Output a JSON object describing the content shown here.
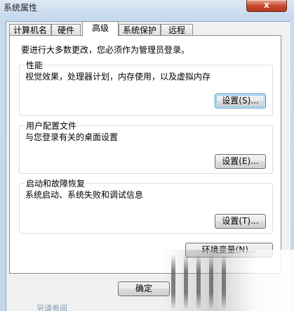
{
  "window": {
    "title": "系统属性",
    "close_label": "x"
  },
  "tabs": [
    {
      "label": "计算机名",
      "active": false
    },
    {
      "label": "硬件",
      "active": false
    },
    {
      "label": "高级",
      "active": true
    },
    {
      "label": "系统保护",
      "active": false
    },
    {
      "label": "远程",
      "active": false
    }
  ],
  "panel": {
    "note": "要进行大多数更改，您必须作为管理员登录。",
    "performance": {
      "title": "性能",
      "description": "视觉效果，处理器计划，内存使用，以及虚拟内存",
      "button": "设置(S)..."
    },
    "user_profiles": {
      "title": "用户配置文件",
      "description": "与您登录有关的桌面设置",
      "button": "设置(E)..."
    },
    "startup_recovery": {
      "title": "启动和故障恢复",
      "description": "系统启动、系统失败和调试信息",
      "button": "设置(T)..."
    },
    "env_button": "环境变量(N)..."
  },
  "footer": {
    "ok_button": "确定",
    "background_text": "另请参阅"
  }
}
